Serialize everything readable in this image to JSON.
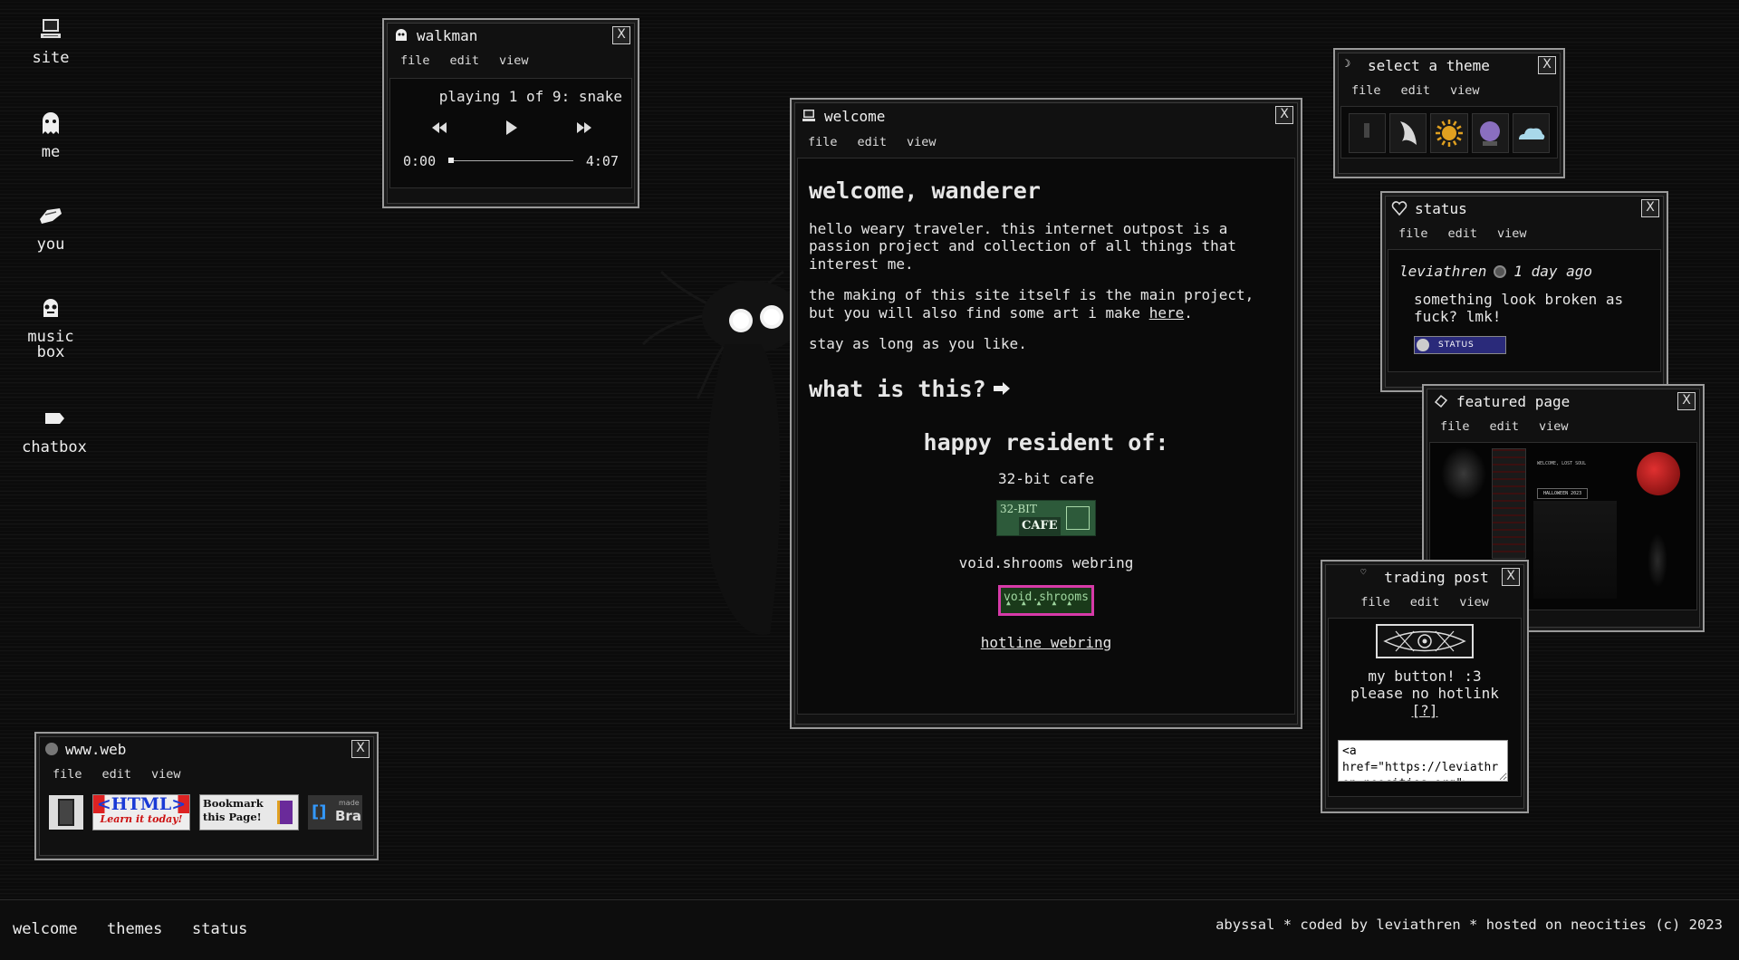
{
  "desktop_icons": [
    {
      "label": "site",
      "icon": "computer-icon"
    },
    {
      "label": "me",
      "icon": "ghost-icon"
    },
    {
      "label": "you",
      "icon": "hand-icon"
    },
    {
      "label": "music box",
      "icon": "creature-icon"
    },
    {
      "label": "chatbox",
      "icon": "speech-icon"
    }
  ],
  "menu": {
    "file": "file",
    "edit": "edit",
    "view": "view"
  },
  "walkman": {
    "title": "walkman",
    "now_playing": "playing 1 of 9: snake",
    "time_current": "0:00",
    "time_total": "4:07",
    "progress": 0.0
  },
  "welcome": {
    "title": "welcome",
    "heading": "welcome, wanderer",
    "para1": "hello weary traveler. this internet outpost is a passion project and collection of all things that interest me.",
    "para2_before": "the making of this site itself is the main project, but you will also find some art i make ",
    "para2_link": "here",
    "para2_after": ".",
    "para3": "stay as long as you like.",
    "what_heading": "what is this?",
    "resident_heading": "happy resident of:",
    "cafe_label": "32-bit cafe",
    "cafe_badge_top": "32-BIT",
    "cafe_badge_bottom": "CAFE",
    "void_label": "void.shrooms webring",
    "void_badge": "void.shrooms",
    "hotline_link": "hotline webring"
  },
  "theme": {
    "title": "select a theme",
    "colors": {
      "sun": "#e0a020",
      "moon": "#8a6fbf",
      "cloud": "#a8d8ea"
    }
  },
  "status": {
    "title": "status",
    "user": "leviathren",
    "time": "1 day ago",
    "message": "something look broken as fuck? lmk!",
    "badge": "STATUS"
  },
  "featured": {
    "title": "featured page",
    "thumb_header": "WELCOME, LOST SOUL",
    "thumb_label": "HALLOWEEN 2023"
  },
  "trading": {
    "title": "trading post",
    "line1": "my button! :3",
    "line2": "please no hotlink",
    "help": "[?]",
    "code": "<a href=\"https://leviathren.neocities.org\">"
  },
  "www": {
    "title": "www.web",
    "btn_html_top": "<HTML>",
    "btn_html_bottom": "Learn it today!",
    "btn_bookmark": "Bookmark this Page!",
    "btn_made_small": "made",
    "btn_made_big": "Bra"
  },
  "taskbar": {
    "items": [
      "welcome",
      "themes",
      "status"
    ],
    "footer": "abyssal * coded by leviathren * hosted on neocities (c) 2023"
  }
}
